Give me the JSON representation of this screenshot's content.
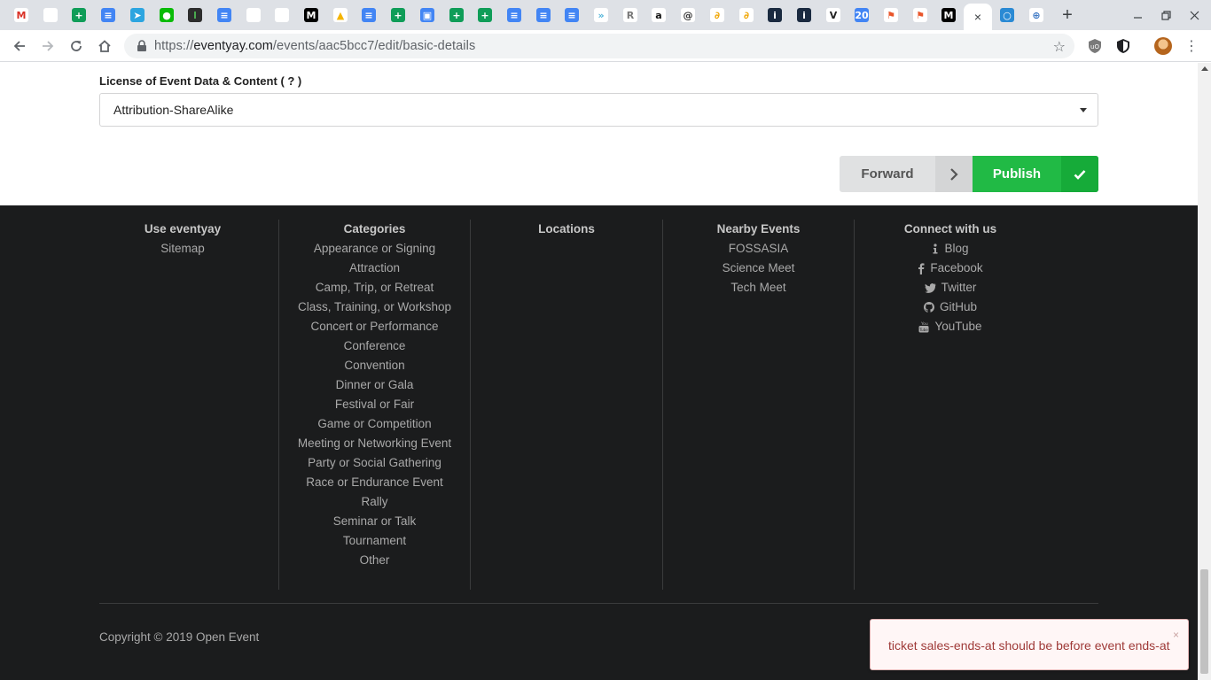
{
  "browser": {
    "url_host": "eventyay.com",
    "url_path": "/events/aac5bcc7/edit/basic-details",
    "url_scheme": "https://",
    "tab_close_glyph": "×",
    "new_tab_glyph": "+",
    "tabs": [
      {
        "icon": "gmail-icon",
        "glyph": "M",
        "color": "#ffffff",
        "fg": "#d93025"
      },
      {
        "icon": "github-icon",
        "glyph": "",
        "color": "#ffffff",
        "fg": "#24292e"
      },
      {
        "icon": "google-sheets-icon",
        "glyph": "+",
        "color": "#0f9d58",
        "fg": "#ffffff"
      },
      {
        "icon": "google-docs-icon",
        "glyph": "≡",
        "color": "#4285f4",
        "fg": "#ffffff"
      },
      {
        "icon": "telegram-icon",
        "glyph": "➤",
        "color": "#2ca5e0",
        "fg": "#ffffff"
      },
      {
        "icon": "wechat-icon",
        "glyph": "●",
        "color": "#09bb07",
        "fg": "#ffffff"
      },
      {
        "icon": "terminal-icon",
        "glyph": "l",
        "color": "#2d2d2d",
        "fg": "#4caf50"
      },
      {
        "icon": "google-docs-icon",
        "glyph": "≡",
        "color": "#4285f4",
        "fg": "#ffffff"
      },
      {
        "icon": "github-icon",
        "glyph": "",
        "color": "#ffffff",
        "fg": "#24292e"
      },
      {
        "icon": "github-icon",
        "glyph": "",
        "color": "#ffffff",
        "fg": "#24292e"
      },
      {
        "icon": "medium-icon",
        "glyph": "M",
        "color": "#000000",
        "fg": "#ffffff"
      },
      {
        "icon": "google-drive-icon",
        "glyph": "▲",
        "color": "#ffffff",
        "fg": "#f4b400"
      },
      {
        "icon": "google-docs-icon",
        "glyph": "≡",
        "color": "#4285f4",
        "fg": "#ffffff"
      },
      {
        "icon": "google-sheets-icon",
        "glyph": "+",
        "color": "#0f9d58",
        "fg": "#ffffff"
      },
      {
        "icon": "chat-icon",
        "glyph": "▣",
        "color": "#4285f4",
        "fg": "#ffffff"
      },
      {
        "icon": "google-sheets-icon",
        "glyph": "+",
        "color": "#0f9d58",
        "fg": "#ffffff"
      },
      {
        "icon": "google-sheets-icon",
        "glyph": "+",
        "color": "#0f9d58",
        "fg": "#ffffff"
      },
      {
        "icon": "google-docs-icon",
        "glyph": "≡",
        "color": "#4285f4",
        "fg": "#ffffff"
      },
      {
        "icon": "google-docs-icon",
        "glyph": "≡",
        "color": "#4285f4",
        "fg": "#ffffff"
      },
      {
        "icon": "google-docs-icon",
        "glyph": "≡",
        "color": "#4285f4",
        "fg": "#ffffff"
      },
      {
        "icon": "arrows-icon",
        "glyph": "»",
        "color": "#ffffff",
        "fg": "#4fb3d9"
      },
      {
        "icon": "r-icon",
        "glyph": "R",
        "color": "#ffffff",
        "fg": "#777777"
      },
      {
        "icon": "amazon-icon",
        "glyph": "a",
        "color": "#ffffff",
        "fg": "#111111"
      },
      {
        "icon": "at-icon",
        "glyph": "@",
        "color": "#ffffff",
        "fg": "#333333"
      },
      {
        "icon": "swirl-icon",
        "glyph": "∂",
        "color": "#ffffff",
        "fg": "#f0a500"
      },
      {
        "icon": "swirl-icon",
        "glyph": "∂",
        "color": "#ffffff",
        "fg": "#f0a500"
      },
      {
        "icon": "info-box-icon",
        "glyph": "i",
        "color": "#1a2a40",
        "fg": "#ffffff"
      },
      {
        "icon": "info-box-icon",
        "glyph": "i",
        "color": "#1a2a40",
        "fg": "#ffffff"
      },
      {
        "icon": "v-icon",
        "glyph": "V",
        "color": "#ffffff",
        "fg": "#222222"
      },
      {
        "icon": "calendar-icon",
        "glyph": "20",
        "color": "#4285f4",
        "fg": "#ffffff"
      },
      {
        "icon": "flag-icon",
        "glyph": "⚑",
        "color": "#ffffff",
        "fg": "#e8552a"
      },
      {
        "icon": "flag-icon",
        "glyph": "⚑",
        "color": "#ffffff",
        "fg": "#e8552a"
      },
      {
        "icon": "medium-icon",
        "glyph": "M",
        "color": "#000000",
        "fg": "#ffffff"
      },
      {
        "icon": "active-tab-close-icon",
        "glyph": "×",
        "color": "#ffffff",
        "fg": "#3c4043",
        "active": true
      },
      {
        "icon": "circle-icon",
        "glyph": "○",
        "color": "#2a8ad4",
        "fg": "#ffffff"
      },
      {
        "icon": "globe-icon",
        "glyph": "⊕",
        "color": "#ffffff",
        "fg": "#3d78c4"
      }
    ]
  },
  "form": {
    "license_label": "License of Event Data & Content",
    "license_help": "( ? )",
    "license_value": "Attribution-ShareAlike"
  },
  "actions": {
    "forward_label": "Forward",
    "publish_label": "Publish"
  },
  "footer": {
    "columns": [
      {
        "key": "use",
        "title": "Use eventyay",
        "links": [
          "Sitemap"
        ]
      },
      {
        "key": "categories",
        "title": "Categories",
        "links": [
          "Appearance or Signing",
          "Attraction",
          "Camp, Trip, or Retreat",
          "Class, Training, or Workshop",
          "Concert or Performance",
          "Conference",
          "Convention",
          "Dinner or Gala",
          "Festival or Fair",
          "Game or Competition",
          "Meeting or Networking Event",
          "Party or Social Gathering",
          "Race or Endurance Event",
          "Rally",
          "Seminar or Talk",
          "Tournament",
          "Other"
        ]
      },
      {
        "key": "locations",
        "title": "Locations",
        "links": []
      },
      {
        "key": "nearby",
        "title": "Nearby Events",
        "links": [
          "FOSSASIA",
          "Science Meet",
          "Tech Meet"
        ]
      },
      {
        "key": "connect",
        "title": "Connect with us",
        "links": []
      }
    ],
    "social": [
      {
        "label": "Blog",
        "icon": "info-icon"
      },
      {
        "label": "Facebook",
        "icon": "facebook-icon"
      },
      {
        "label": "Twitter",
        "icon": "twitter-icon"
      },
      {
        "label": "GitHub",
        "icon": "github-icon"
      },
      {
        "label": "YouTube",
        "icon": "youtube-icon"
      }
    ],
    "copyright": "Copyright © 2019 Open Event"
  },
  "toast": {
    "message": "ticket sales-ends-at should be before event ends-at",
    "close_glyph": "×"
  },
  "colors": {
    "publish_green": "#21ba45",
    "footer_bg": "#1b1c1d",
    "toast_text": "#9f3a38"
  }
}
